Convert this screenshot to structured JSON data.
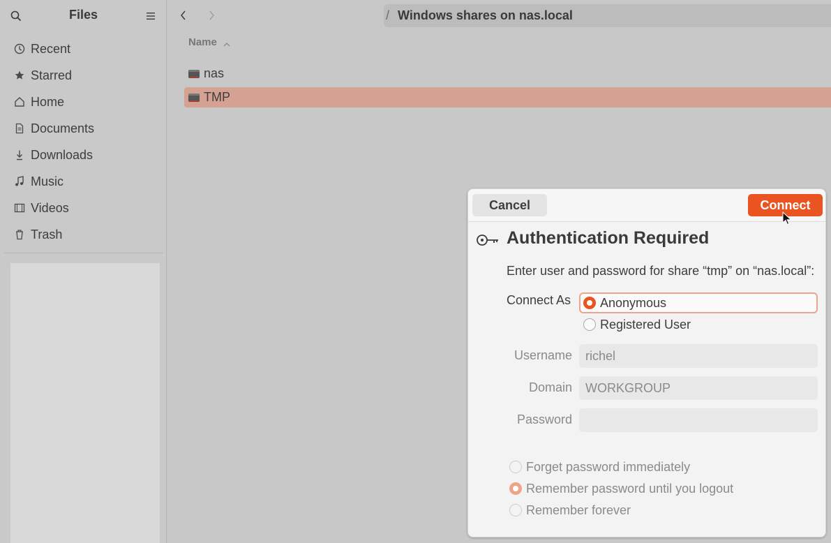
{
  "app": {
    "title": "Files"
  },
  "sidebar": {
    "items": [
      {
        "label": "Recent",
        "icon": "clock-icon"
      },
      {
        "label": "Starred",
        "icon": "star-icon"
      },
      {
        "label": "Home",
        "icon": "home-icon"
      },
      {
        "label": "Documents",
        "icon": "document-icon"
      },
      {
        "label": "Downloads",
        "icon": "download-icon"
      },
      {
        "label": "Music",
        "icon": "music-icon"
      },
      {
        "label": "Videos",
        "icon": "video-icon"
      },
      {
        "label": "Trash",
        "icon": "trash-icon"
      }
    ]
  },
  "path": {
    "separator": "/",
    "label": "Windows shares on nas.local"
  },
  "list": {
    "column_name": "Name",
    "items": [
      {
        "name": "nas",
        "selected": false
      },
      {
        "name": "TMP",
        "selected": true
      }
    ]
  },
  "dialog": {
    "cancel_label": "Cancel",
    "connect_label": "Connect",
    "title": "Authentication Required",
    "message": "Enter user and password for share “tmp” on “nas.local”:",
    "connect_as_label": "Connect As",
    "options": {
      "anonymous": "Anonymous",
      "registered": "Registered User"
    },
    "username_label": "Username",
    "username_value": "richel",
    "domain_label": "Domain",
    "domain_value": "WORKGROUP",
    "password_label": "Password",
    "password_value": "",
    "remember": {
      "forget": "Forget password immediately",
      "until_logout": "Remember password until you logout",
      "forever": "Remember forever"
    }
  },
  "colors": {
    "accent": "#e95420",
    "selection": "#d4a193",
    "sidebar_bg": "#c9c9c9"
  }
}
